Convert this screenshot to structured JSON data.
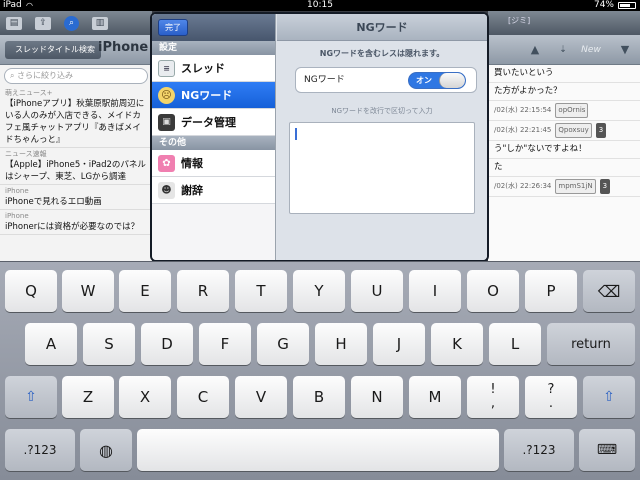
{
  "status_bar": {
    "carrier": "iPad",
    "time": "10:15",
    "battery": "74%",
    "battery_fraction": 0.74
  },
  "left_app": {
    "toolbar_icons": [
      "folder-icon",
      "upload-icon",
      "search-icon",
      "book-icon"
    ],
    "back_button": "スレッドタイトル検索",
    "title": "iPhone",
    "search_placeholder": "さらに絞り込み",
    "rows": [
      {
        "category": "萌えニュース+",
        "title": "【iPhoneアプリ】秋葉原駅前周辺にいる人のみが入店できる、メイドカフェ風チャットアプリ『あきばメイドちゃんっと』"
      },
      {
        "category": "ニュース速報",
        "title": "【Apple】iPhone5・iPad2のパネルはシャープ、東芝、LGから調達"
      },
      {
        "category": "iPhone",
        "title": "iPhoneで見れるエロ動画"
      },
      {
        "category": "iPhone",
        "title": "iPhonerには資格が必要なのでは？"
      }
    ]
  },
  "right_app": {
    "toolbar_tag": "[ジミ]",
    "up_arrow": "▲",
    "new_button": "New",
    "down_arrow": "▼",
    "rows": [
      {
        "text": "買いたいという"
      },
      {
        "text": "た方がよかった？"
      },
      {
        "meta_date": "/02(水) 22:15:54",
        "meta_id": "opOrnis"
      },
      {
        "meta_date": "/02(水) 22:21:45",
        "meta_id": "Qpoxsuy",
        "meta_count": "3"
      },
      {
        "text": "う\"しか\"ないですよね！"
      },
      {
        "text": "た"
      },
      {
        "meta_date": "/02(水) 22:26:34",
        "meta_id": "mpmS1jN",
        "meta_count": "3"
      }
    ]
  },
  "popover": {
    "done_label": "完了",
    "section_settings": "設定",
    "section_other": "その他",
    "menu": [
      {
        "label": "スレッド",
        "icon": "thread-list-icon"
      },
      {
        "label": "NGワード",
        "icon": "ng-face-icon"
      },
      {
        "label": "データ管理",
        "icon": "briefcase-icon"
      }
    ],
    "menu_other": [
      {
        "label": "情報",
        "icon": "info-icon"
      },
      {
        "label": "謝辞",
        "icon": "person-icon"
      }
    ],
    "detail_title": "NGワード",
    "detail_note": "NGワードを含むレスは隠れます。",
    "toggle_label": "NGワード",
    "toggle_value": "オン",
    "hint": "NGワードを改行で区切って入力",
    "textarea_value": ""
  },
  "keyboard": {
    "row1": [
      "Q",
      "W",
      "E",
      "R",
      "T",
      "Y",
      "U",
      "I",
      "O",
      "P"
    ],
    "backspace_icon": "backspace-icon",
    "row2": [
      "A",
      "S",
      "D",
      "F",
      "G",
      "H",
      "J",
      "K",
      "L"
    ],
    "return_label": "return",
    "shift_icon": "shift-icon",
    "row3": [
      "Z",
      "X",
      "C",
      "V",
      "B",
      "N",
      "M"
    ],
    "punct1": "!,",
    "punct2": "?.",
    "numbers_label": ".?123",
    "globe_icon": "globe-icon",
    "hide_keyboard_icon": "hide-keyboard-icon"
  }
}
